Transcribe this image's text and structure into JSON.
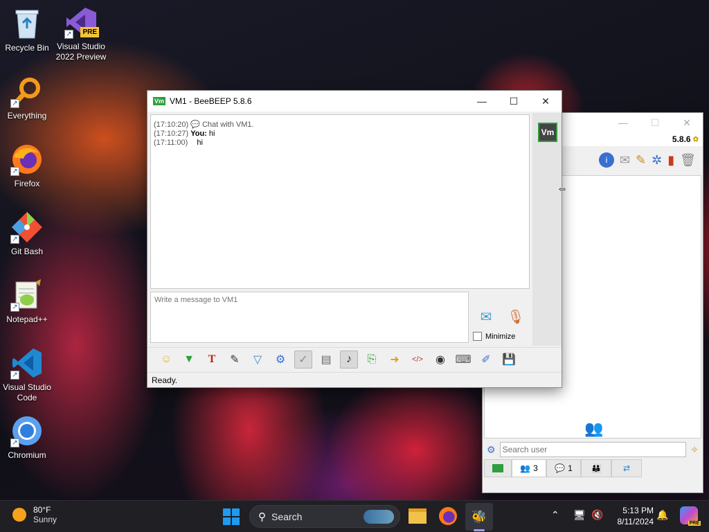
{
  "desktop": {
    "icons": [
      {
        "label": "Recycle Bin"
      },
      {
        "label": "Visual Studio 2022 Preview",
        "badge": "PRE"
      },
      {
        "label": "Everything"
      },
      {
        "label": "Firefox"
      },
      {
        "label": "Git Bash"
      },
      {
        "label": "Notepad++"
      },
      {
        "label": "Visual Studio Code"
      },
      {
        "label": "Chromium"
      }
    ]
  },
  "chat_window": {
    "title": "VM1 - BeeBEEP 5.8.6",
    "app_badge": "Vm",
    "avatar": "Vm",
    "messages": [
      {
        "time": "(17:10:20)",
        "author": "",
        "text": "Chat with VM1."
      },
      {
        "time": "(17:10:27)",
        "author": "You:",
        "text": "hi"
      },
      {
        "time": "(17:11:00)",
        "author": "",
        "text": "hi"
      }
    ],
    "input_placeholder": "Write a message to VM1",
    "minimize_label": "Minimize",
    "status": "Ready."
  },
  "main_window": {
    "version": "5.8.6",
    "search_placeholder": "Search user",
    "tabs": [
      {
        "count": ""
      },
      {
        "count": "3"
      },
      {
        "count": "1"
      },
      {
        "count": ""
      },
      {
        "count": ""
      }
    ]
  },
  "taskbar": {
    "weather": {
      "temp": "80°F",
      "condition": "Sunny"
    },
    "search_label": "Search",
    "clock": {
      "time": "5:13 PM",
      "date": "8/11/2024"
    },
    "copilot_badge": "PRE"
  },
  "colors": {
    "accent_green": "#2e9e3e",
    "taskbar_bg": "#1f1f24",
    "windows_blue": "#1d9bf0"
  }
}
